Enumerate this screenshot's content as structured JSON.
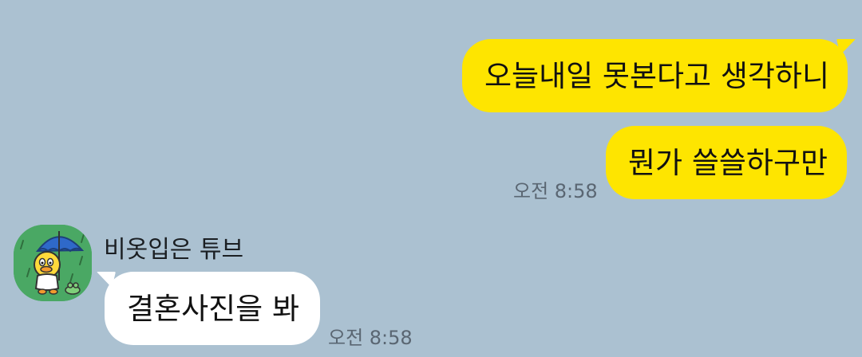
{
  "messages": {
    "outgoing": [
      {
        "text": "오늘내일 못본다고 생각하니"
      },
      {
        "text": "뭔가 쓸쓸하구만",
        "time": "오전 8:58"
      }
    ],
    "incoming": {
      "sender": "비옷입은 튜브",
      "avatar_icon": "tube-raincoat-umbrella-avatar",
      "text": "결혼사진을 봐",
      "time": "오전 8:58"
    }
  },
  "colors": {
    "background": "#abc1d1",
    "my_bubble": "#fee500",
    "their_bubble": "#ffffff",
    "avatar_bg": "#4aa864"
  }
}
